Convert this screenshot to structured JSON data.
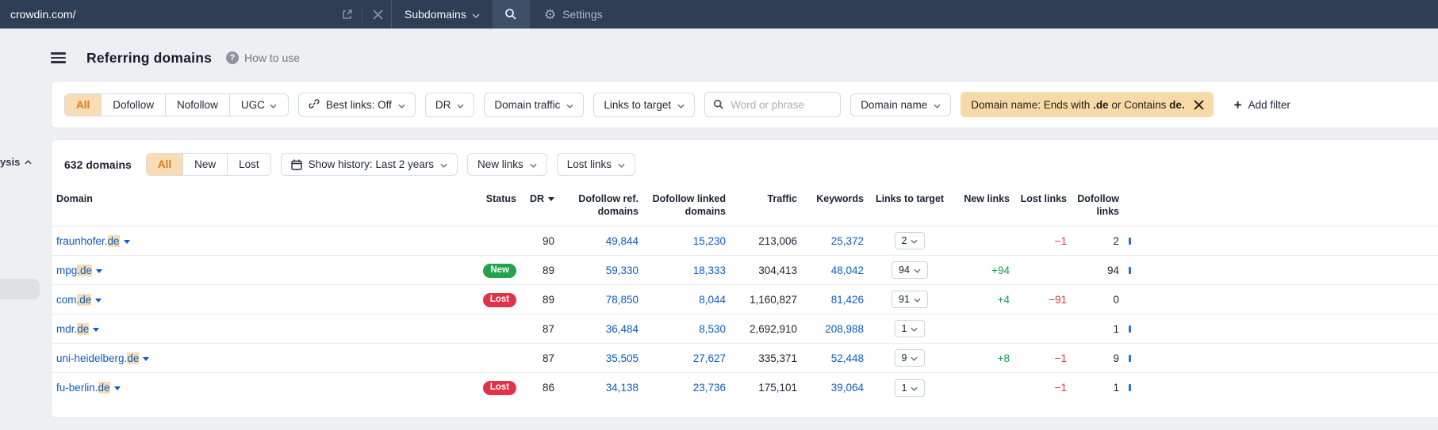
{
  "topbar": {
    "url": "crowdin.com/",
    "mode": "Subdomains",
    "settings_label": "Settings"
  },
  "header": {
    "title": "Referring domains",
    "help_label": "How to use"
  },
  "icons": {
    "question_glyph": "?",
    "plus_glyph": "+",
    "gear_glyph": "⚙"
  },
  "filter_bar": {
    "type_tabs": {
      "selected": "All",
      "items": [
        {
          "label": "All",
          "chevron": false
        },
        {
          "label": "Dofollow",
          "chevron": false
        },
        {
          "label": "Nofollow",
          "chevron": false
        },
        {
          "label": "UGC",
          "chevron": true
        }
      ]
    },
    "buttons": [
      {
        "label": "Best links: Off",
        "icon": "link-icon"
      },
      {
        "label": "DR",
        "icon": null
      },
      {
        "label": "Domain traffic",
        "icon": null
      },
      {
        "label": "Links to target",
        "icon": null
      }
    ],
    "search_placeholder": "Word or phrase",
    "domain_name_button": "Domain name",
    "active_filter": {
      "parts": [
        {
          "text": "Domain name: Ends with ",
          "bold": false
        },
        {
          "text": ".de",
          "bold": true
        },
        {
          "text": " or Contains ",
          "bold": false
        },
        {
          "text": "de.",
          "bold": true
        }
      ]
    },
    "add_filter_label": "Add filter"
  },
  "toolbar": {
    "count": "632 domains",
    "status_tabs": {
      "selected": "All",
      "items": [
        "All",
        "New",
        "Lost"
      ]
    },
    "history_button": "Show history: Last 2 years",
    "new_links_button": "New links",
    "lost_links_button": "Lost links"
  },
  "table": {
    "columns": [
      {
        "label": "Domain",
        "align": "al",
        "sort": false
      },
      {
        "label": "Status",
        "align": "ar",
        "sort": false
      },
      {
        "label": "DR",
        "align": "ar",
        "sort": true
      },
      {
        "label": "Dofollow ref.\ndomains",
        "align": "ar",
        "sort": false
      },
      {
        "label": "Dofollow linked\ndomains",
        "align": "ar",
        "sort": false
      },
      {
        "label": "Traffic",
        "align": "ar",
        "sort": false
      },
      {
        "label": "Keywords",
        "align": "ar",
        "sort": false
      },
      {
        "label": "Links to target",
        "align": "ac",
        "sort": false
      },
      {
        "label": "New links",
        "align": "ar",
        "sort": false
      },
      {
        "label": "Lost links",
        "align": "ar",
        "sort": false
      },
      {
        "label": "Dofollow\nlinks",
        "align": "ar",
        "sort": false
      }
    ],
    "rows": [
      {
        "domain_prefix": "fraunhofer.",
        "domain_highlight": "de",
        "status": "",
        "dr": "90",
        "dofollow_ref_domains": "49,844",
        "dofollow_linked_domains": "15,230",
        "traffic": "213,006",
        "keywords": "25,372",
        "links_to_target": "2",
        "new_links": "",
        "lost_links": "−1",
        "dofollow_links": "2",
        "has_bar": true
      },
      {
        "domain_prefix": "mpg",
        "domain_highlight": ".de",
        "status": "New",
        "dr": "89",
        "dofollow_ref_domains": "59,330",
        "dofollow_linked_domains": "18,333",
        "traffic": "304,413",
        "keywords": "48,042",
        "links_to_target": "94",
        "new_links": "+94",
        "lost_links": "",
        "dofollow_links": "94",
        "has_bar": true
      },
      {
        "domain_prefix": "com",
        "domain_highlight": ".de",
        "status": "Lost",
        "dr": "89",
        "dofollow_ref_domains": "78,850",
        "dofollow_linked_domains": "8,044",
        "traffic": "1,160,827",
        "keywords": "81,426",
        "links_to_target": "91",
        "new_links": "+4",
        "lost_links": "−91",
        "dofollow_links": "0",
        "has_bar": false
      },
      {
        "domain_prefix": "mdr.",
        "domain_highlight": "de",
        "status": "",
        "dr": "87",
        "dofollow_ref_domains": "36,484",
        "dofollow_linked_domains": "8,530",
        "traffic": "2,692,910",
        "keywords": "208,988",
        "links_to_target": "1",
        "new_links": "",
        "lost_links": "",
        "dofollow_links": "1",
        "has_bar": true
      },
      {
        "domain_prefix": "uni-heidelberg.",
        "domain_highlight": "de",
        "status": "",
        "dr": "87",
        "dofollow_ref_domains": "35,505",
        "dofollow_linked_domains": "27,627",
        "traffic": "335,371",
        "keywords": "52,448",
        "links_to_target": "9",
        "new_links": "+8",
        "lost_links": "−1",
        "dofollow_links": "9",
        "has_bar": true
      },
      {
        "domain_prefix": "fu-berlin.",
        "domain_highlight": "de",
        "status": "Lost",
        "dr": "86",
        "dofollow_ref_domains": "34,138",
        "dofollow_linked_domains": "23,736",
        "traffic": "175,101",
        "keywords": "39,064",
        "links_to_target": "1",
        "new_links": "",
        "lost_links": "−1",
        "dofollow_links": "1",
        "has_bar": true
      }
    ]
  },
  "sidebar_fragment": {
    "text": "ysis"
  },
  "colors": {
    "topbar_bg": "#2e3e54",
    "accent_orange": "#e07818",
    "highlight": "#f8dcb2",
    "link_blue": "#0b5cc2",
    "badge_new": "#23a14b",
    "badge_lost": "#e23247",
    "positive": "#149a52",
    "negative": "#d33b3e"
  }
}
